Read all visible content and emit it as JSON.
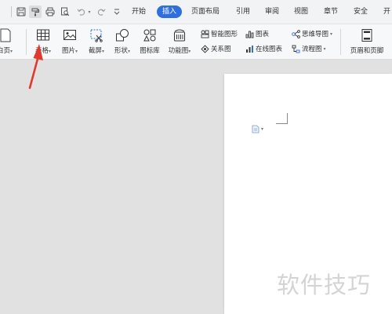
{
  "tabs": [
    {
      "label": "开始",
      "active": false
    },
    {
      "label": "插入",
      "active": true
    },
    {
      "label": "页面布局",
      "active": false
    },
    {
      "label": "引用",
      "active": false
    },
    {
      "label": "审阅",
      "active": false
    },
    {
      "label": "视图",
      "active": false
    },
    {
      "label": "章节",
      "active": false
    },
    {
      "label": "安全",
      "active": false
    },
    {
      "label": "开"
    }
  ],
  "ribbon": {
    "blank_page": "白页",
    "table": "表格",
    "picture": "图片",
    "screenshot": "截屏",
    "shape": "形状",
    "icon_library": "图标库",
    "function_chart": "功能图",
    "smart_graphic": "智能图形",
    "chart": "图表",
    "relation_chart": "关系图",
    "online_chart": "在线图表",
    "mind_map": "思维导图",
    "flowchart": "流程图",
    "header_footer": "页眉和页脚",
    "caret": "▾"
  },
  "watermark": "软件技巧",
  "colors": {
    "accent": "#2e6fdd",
    "arrow": "#e03a2f"
  },
  "icons": [
    "save-icon",
    "format-painter-icon",
    "print-icon",
    "print-preview-icon",
    "undo-icon",
    "redo-icon",
    "dropdown-icon"
  ]
}
